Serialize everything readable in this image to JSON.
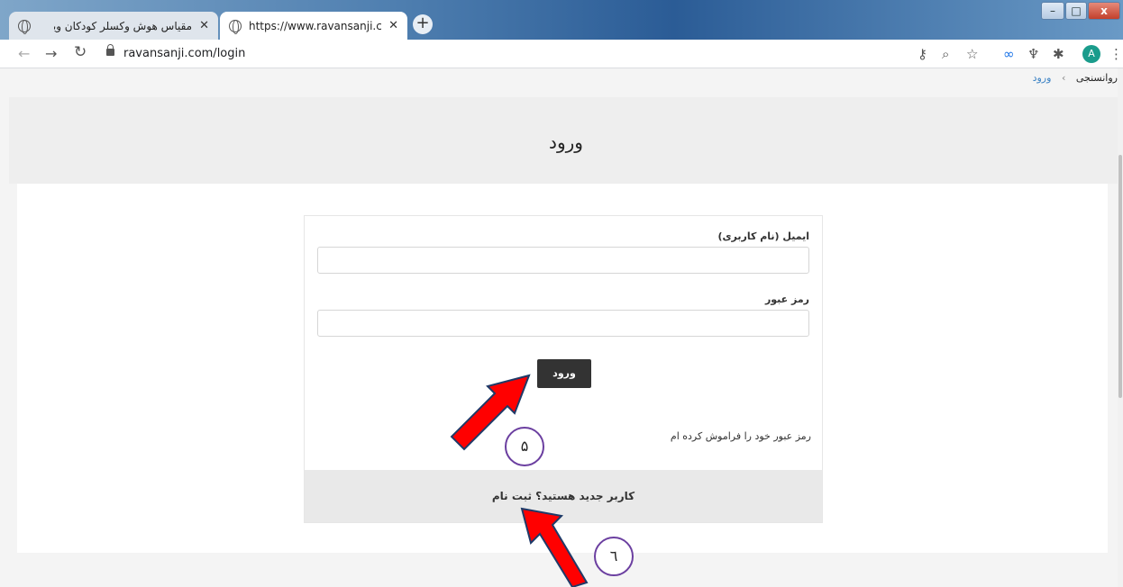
{
  "browser": {
    "tabs": [
      {
        "label": "مقیاس هوش وکسلر کودکان ویرایش پنجم",
        "active": false
      },
      {
        "label": "https://www.ravansanji.com/login",
        "active": true
      }
    ],
    "new_tab": "+",
    "url": "ravansanji.com/login",
    "avatar_letter": "A",
    "window_controls": {
      "minimize": "–",
      "maximize": "□",
      "close": "x"
    }
  },
  "breadcrumb": {
    "home": "روانسنجی",
    "current": "ورود",
    "separator": "›"
  },
  "page": {
    "title": "ورود",
    "email_label": "ایمیل (نام کاربری)",
    "password_label": "رمز عبور",
    "login_button": "ورود",
    "forgot_password": "رمز عبور خود را فراموش کرده ام",
    "signup_prompt": "کاربر جدید هستید؟ ثبت نام"
  },
  "annotations": [
    {
      "number": "۵"
    },
    {
      "number": "٦"
    }
  ],
  "colors": {
    "arrow": "#ff0000",
    "arrow_outline": "#1f3a68",
    "button": "#333333",
    "circle_border": "#6b3fa0"
  }
}
